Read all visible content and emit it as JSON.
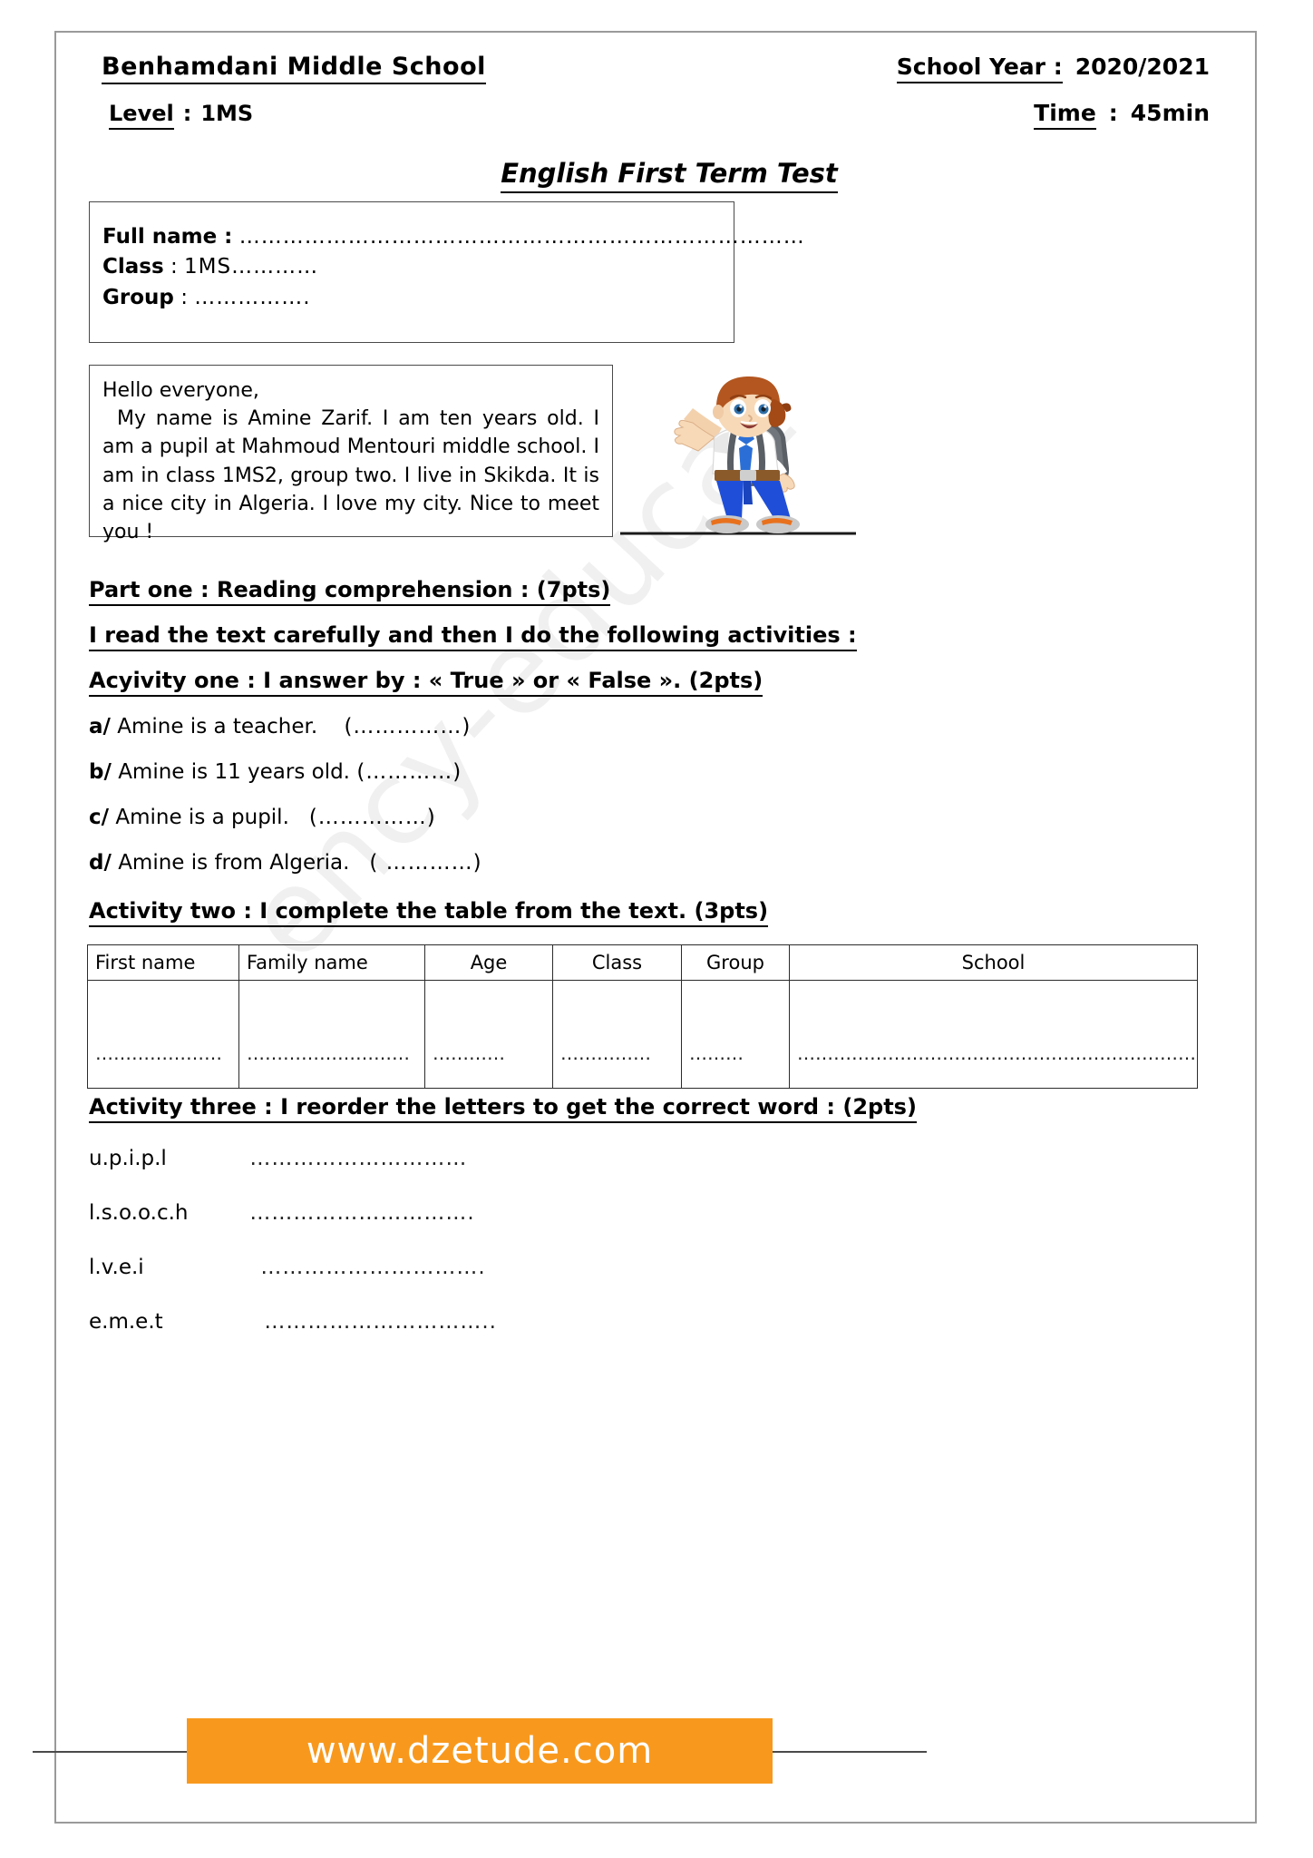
{
  "watermark": {
    "text": "ency-education.com/exams"
  },
  "header": {
    "school_name": "Benhamdani Middle School",
    "school_year_label": "School Year :",
    "school_year_value": "2020/2021",
    "level_label": "Level",
    "level_sep": ":",
    "level_value": "1MS",
    "time_label": "Time",
    "time_sep": ":",
    "time_value": "45min"
  },
  "title": "English First Term Test",
  "identity": {
    "full_name_label": "Full name  :",
    "full_name_dots": "……………………………………………………………………",
    "class_label": "Class",
    "class_sep": ":",
    "class_value": "1MS…………",
    "group_label": "Group",
    "group_sep": ":",
    "group_dots": "……………."
  },
  "passage": {
    "greeting": "Hello everyone,",
    "body": "My name is Amine Zarif. I am ten years old. I am a pupil at Mahmoud Mentouri middle school. I am in class  1MS2, group two. I live in Skikda. It is a nice city in Algeria. I love my city. Nice to meet you !"
  },
  "illustration": {
    "name": "cartoon-schoolboy-waving"
  },
  "part_one": {
    "heading": "Part one :  Reading  comprehension : (7pts)",
    "instruction": "I read the text carefully and then I do the following activities :"
  },
  "activity_one": {
    "heading": "Acyivity one : I answer by : « True » or  «  False ». (2pts)",
    "items": [
      {
        "marker": "a/",
        "text": "Amine is  a teacher.",
        "answer_dots": "(……………)"
      },
      {
        "marker": "b/",
        "text": "Amine is  11 years  old.",
        "answer_dots": "(…………)"
      },
      {
        "marker": "c/",
        "text": "Amine is a pupil.",
        "answer_dots": "(……………)"
      },
      {
        "marker": "d/",
        "text": "Amine is from Algeria.",
        "answer_dots": "( …………)"
      }
    ]
  },
  "activity_two": {
    "heading": "Activity two : I complete the table from the text. (3pts)",
    "table": {
      "columns": [
        "First name",
        "Family name",
        "Age",
        "Class",
        "Group",
        "School"
      ],
      "rows": [
        [
          "…………………",
          "………………………",
          "…………",
          "……………",
          "………",
          "…………………………………………………………"
        ]
      ]
    }
  },
  "activity_three": {
    "heading": "Activity three :  I reorder the letters to get the correct word : (2pts)",
    "items": [
      {
        "scrambled": "u.p.i.p.l",
        "answer_dots": "…………………………"
      },
      {
        "scrambled": "l.s.o.o.c.h",
        "answer_dots": "…………………………."
      },
      {
        "scrambled": "l.v.e.i",
        "answer_dots": "…………………………."
      },
      {
        "scrambled": "e.m.e.t",
        "answer_dots": "………………………….."
      }
    ]
  },
  "footer": {
    "site": "www.dzetude.com",
    "color": "#f8991d"
  }
}
